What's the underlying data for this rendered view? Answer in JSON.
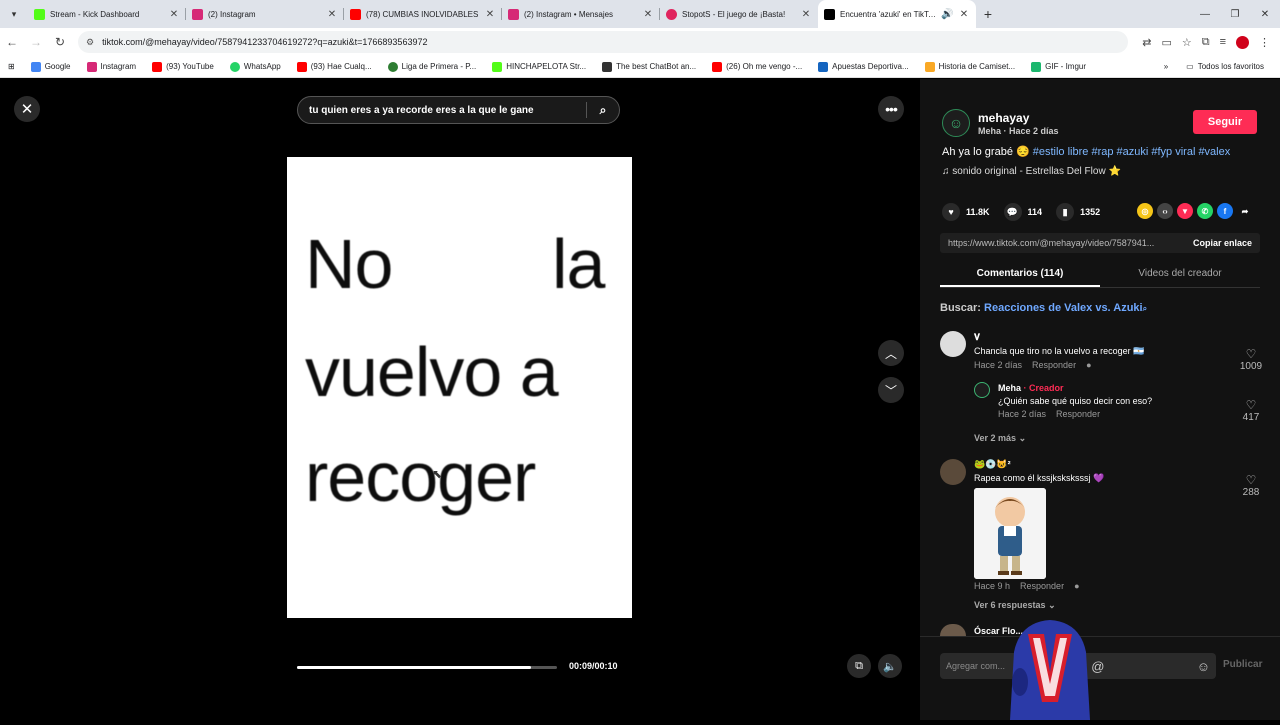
{
  "browser": {
    "tabs": [
      {
        "title": "Stream - Kick Dashboard",
        "favicon_color": "#53fc18",
        "active": false
      },
      {
        "title": "(2) Instagram",
        "favicon_color": "#d62976",
        "active": false
      },
      {
        "title": "(78) CUMBIAS INOLVIDABLES",
        "favicon_color": "#ff0000",
        "active": false
      },
      {
        "title": "(2) Instagram • Mensajes",
        "favicon_color": "#d62976",
        "active": false
      },
      {
        "title": "StopotS - El juego de ¡Basta!",
        "favicon_color": "#e0245e",
        "active": false
      },
      {
        "title": "Encuentra 'azuki' en TikTok",
        "favicon_color": "#000000",
        "active": true
      }
    ],
    "url": "tiktok.com/@mehayay/video/7587941233704619272?q=azuki&t=1766893563972",
    "bookmarks": [
      {
        "label": "Google",
        "color": "#4285f4"
      },
      {
        "label": "Instagram",
        "color": "#d62976"
      },
      {
        "label": "(93) YouTube",
        "color": "#ff0000"
      },
      {
        "label": "WhatsApp",
        "color": "#25d366"
      },
      {
        "label": "(93) Hae Cualq...",
        "color": "#ff0000"
      },
      {
        "label": "Liga de Primera - P...",
        "color": "#2e7d32"
      },
      {
        "label": "HINCHAPELOTA Str...",
        "color": "#53fc18"
      },
      {
        "label": "The best ChatBot an...",
        "color": "#333333"
      },
      {
        "label": "(26) Oh me vengo -...",
        "color": "#ff0000"
      },
      {
        "label": "Apuestas Deportiva...",
        "color": "#1565c0"
      },
      {
        "label": "Historia de Camiset...",
        "color": "#f9a825"
      },
      {
        "label": "GIF - Imgur",
        "color": "#1bb76e"
      }
    ],
    "all_bookmarks": "Todos los favoritos"
  },
  "viewer": {
    "search_query": "tu quien eres a ya recorde eres a la que le gane",
    "video_text": {
      "line1a": "No",
      "line1b": "la",
      "line2": "vuelvo a",
      "line3": "recoger"
    },
    "progress": 0.9,
    "time": "00:09/00:10"
  },
  "panel": {
    "author": "mehayay",
    "author_sub": "Meha · Hace 2 días",
    "follow_label": "Seguir",
    "caption_text": "Ah ya lo grabé 😔 ",
    "caption_tags": "#estilo libre #rap #azuki #fyp viral #valex",
    "sound": "♫  sonido original - Estrellas Del Flow ⭐",
    "likes": "11.8K",
    "comments": "114",
    "saves": "1352",
    "link": "https://www.tiktok.com/@mehayay/video/7587941...",
    "copy_label": "Copiar enlace",
    "tab_comments": "Comentarios (114)",
    "tab_creator": "Videos del creador",
    "search_prefix": "Buscar: ",
    "search_suggestion": "Reacciones de Valex vs. Azuki",
    "comments_list": {
      "c1": {
        "name": "𝐕",
        "text": "Chancla que tiro no la vuelvo a recoger 🇦🇷",
        "time": "Hace 2 días",
        "reply": "Responder",
        "likes": "1009"
      },
      "r1": {
        "name": "Meha",
        "badge": " · Creador",
        "text": "¿Quién sabe qué quiso decir con eso?",
        "time": "Hace 2 días",
        "reply": "Responder",
        "likes": "417"
      },
      "more1": "Ver 2 más",
      "c2": {
        "name": "🐸💿😺²",
        "text": "Rapea como él kssjksksksssj 💜",
        "time": "Hace 9 h",
        "reply": "Responder",
        "likes": "288"
      },
      "more2": "Ver 6 respuestas",
      "c3": {
        "name": "Óscar Flo..."
      }
    },
    "comment_placeholder": "Agregar com...",
    "publish_label": "Publicar"
  }
}
